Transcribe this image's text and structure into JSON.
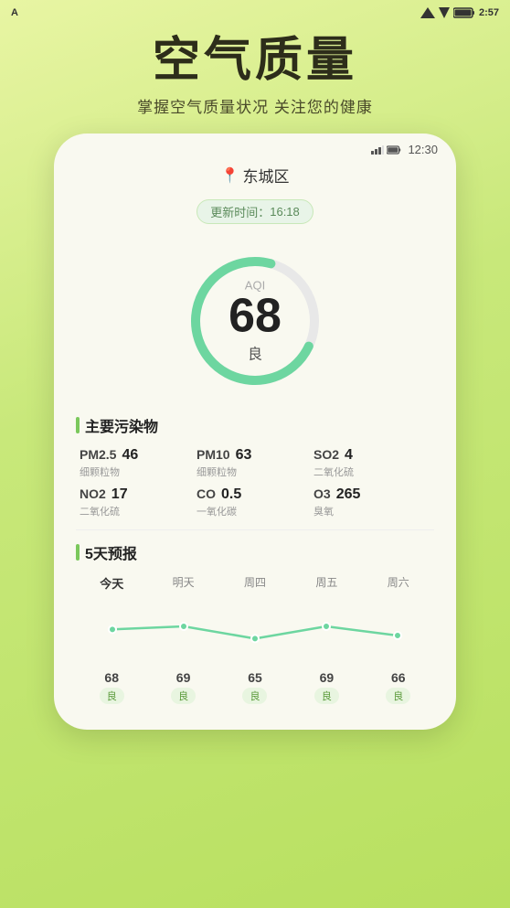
{
  "statusBar": {
    "appLabel": "A",
    "signal": "▲",
    "wifi": "▼",
    "battery": "🔋",
    "time": "2:57"
  },
  "header": {
    "title": "空气质量",
    "subtitle": "掌握空气质量状况 关注您的健康"
  },
  "phone": {
    "statusTime": "12:30",
    "location": "东城区",
    "updateLabel": "更新时间：",
    "updateTime": "16:18",
    "aqi": {
      "label": "AQI",
      "value": "68",
      "quality": "良"
    },
    "pollutantsTitle": "主要污染物",
    "pollutants": [
      {
        "name": "PM2.5",
        "value": "46",
        "desc": "细颗粒物"
      },
      {
        "name": "PM10",
        "value": "63",
        "desc": "细颗粒物"
      },
      {
        "name": "SO2",
        "value": "4",
        "desc": "二氧化硫"
      },
      {
        "name": "NO2",
        "value": "17",
        "desc": "二氧化硫"
      },
      {
        "name": "CO",
        "value": "0.5",
        "desc": "一氧化碳"
      },
      {
        "name": "O3",
        "value": "265",
        "desc": "臭氧"
      }
    ],
    "forecastTitle": "5天预报",
    "forecast": [
      {
        "day": "今天",
        "value": "68",
        "quality": "良",
        "isToday": true
      },
      {
        "day": "明天",
        "value": "69",
        "quality": "良",
        "isToday": false
      },
      {
        "day": "周四",
        "value": "65",
        "quality": "良",
        "isToday": false
      },
      {
        "day": "周五",
        "value": "69",
        "quality": "良",
        "isToday": false
      },
      {
        "day": "周六",
        "value": "66",
        "quality": "良",
        "isToday": false
      }
    ],
    "colors": {
      "aqi_ring": "#6dd6a0",
      "accent": "#7bc85c"
    }
  }
}
